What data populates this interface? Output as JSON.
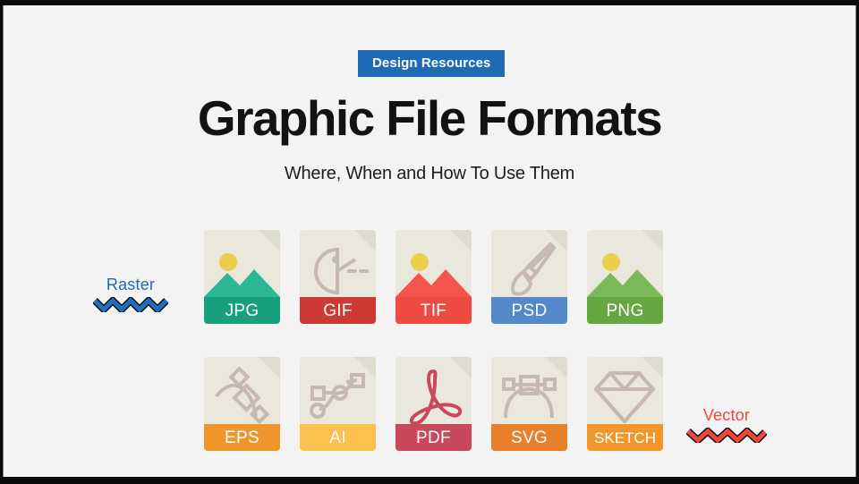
{
  "slide": {
    "background": "#f3f3f3",
    "frame_color": "#0a0a0a"
  },
  "header": {
    "badge_label": "Design Resources",
    "badge_bg": "#1f6ab5",
    "badge_text_color": "#ffffff",
    "title": "Graphic File Formats",
    "subtitle": "Where, When and How To Use Them"
  },
  "categories": [
    {
      "label": "Raster",
      "color": "#1f6ab5",
      "position": "left"
    },
    {
      "label": "Vector",
      "color": "#f4453c",
      "position": "right"
    }
  ],
  "file_rows": [
    {
      "row_name": "raster-formats",
      "files": [
        {
          "label": "JPG",
          "bar_color": "#18a07c",
          "icon": "photo-mountain-icon",
          "art_color": "#2bb795",
          "art_color_dark": "#18a07c",
          "sun_color": "#ecce4e"
        },
        {
          "label": "GIF",
          "bar_color": "#cd3a36",
          "icon": "animation-pacman-icon",
          "art_color": "#c6b8b2"
        },
        {
          "label": "TIF",
          "bar_color": "#ef4b42",
          "icon": "photo-mountain-icon",
          "art_color": "#f4544a",
          "art_color_dark": "#e1433c",
          "sun_color": "#ecce4e"
        },
        {
          "label": "PSD",
          "bar_color": "#5389c9",
          "icon": "paintbrush-icon",
          "art_color": "#c6b8b2"
        },
        {
          "label": "PNG",
          "bar_color": "#66a742",
          "icon": "photo-mountain-icon",
          "art_color": "#7cb85a",
          "art_color_dark": "#66a742",
          "sun_color": "#ecce4e"
        }
      ]
    },
    {
      "row_name": "vector-formats",
      "files": [
        {
          "label": "EPS",
          "bar_color": "#ee962b",
          "icon": "bezier-anchor-icon",
          "art_color": "#c6b8b2"
        },
        {
          "label": "AI",
          "bar_color": "#fbc04e",
          "icon": "node-path-icon",
          "art_color": "#c6b8b2"
        },
        {
          "label": "PDF",
          "bar_color": "#c9485b",
          "icon": "acrobat-swirl-icon",
          "art_color": "#c9485b"
        },
        {
          "label": "SVG",
          "bar_color": "#e8802a",
          "icon": "bezier-curve-icon",
          "art_color": "#c6b8b2"
        },
        {
          "label": "SKETCH",
          "bar_color": "#f0962b",
          "icon": "diamond-gem-icon",
          "art_color": "#c6b8b2"
        }
      ]
    }
  ]
}
